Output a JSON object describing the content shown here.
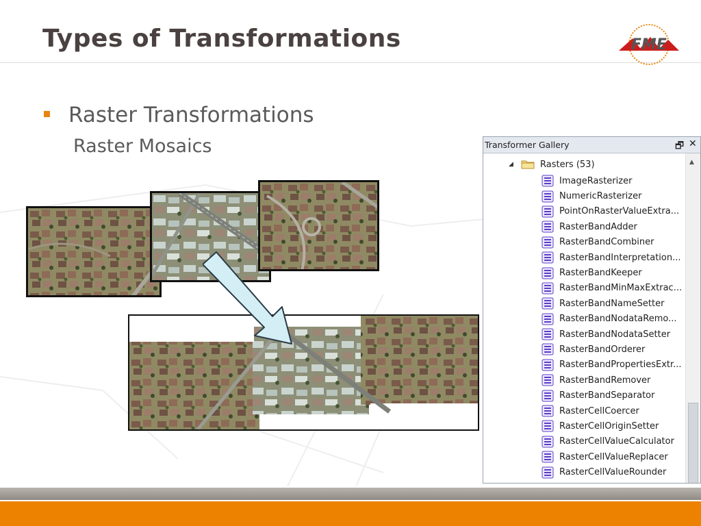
{
  "slide": {
    "title": "Types of Transformations",
    "bullet": "Raster Transformations",
    "subbullet": "Raster Mosaics"
  },
  "colors": {
    "accent_orange": "#ec8200",
    "title_color": "#4a4241",
    "footer_gray": "#9a958f",
    "arrow_fill": "#d4eef6"
  },
  "gallery": {
    "title": "Transformer Gallery",
    "restore_icon": "restore-window-icon",
    "close_icon": "close-icon",
    "root": {
      "label": "Rasters (53)",
      "expanded": true
    },
    "items": [
      "ImageRasterizer",
      "NumericRasterizer",
      "PointOnRasterValueExtra...",
      "RasterBandAdder",
      "RasterBandCombiner",
      "RasterBandInterpretation...",
      "RasterBandKeeper",
      "RasterBandMinMaxExtrac...",
      "RasterBandNameSetter",
      "RasterBandNodataRemo...",
      "RasterBandNodataSetter",
      "RasterBandOrderer",
      "RasterBandPropertiesExtr...",
      "RasterBandRemover",
      "RasterBandSeparator",
      "RasterCellCoercer",
      "RasterCellOriginSetter",
      "RasterCellValueCalculator",
      "RasterCellValueReplacer",
      "RasterCellValueRounder"
    ]
  }
}
